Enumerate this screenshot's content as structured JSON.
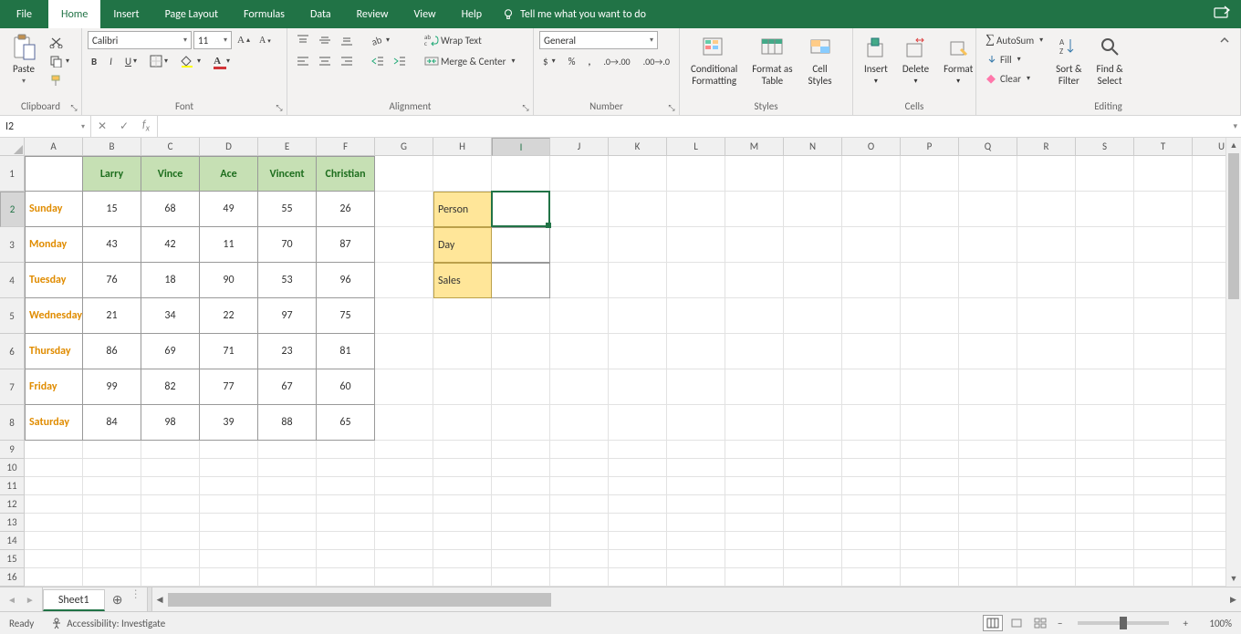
{
  "tabs": {
    "file": "File",
    "home": "Home",
    "insert": "Insert",
    "page_layout": "Page Layout",
    "formulas": "Formulas",
    "data": "Data",
    "review": "Review",
    "view": "View",
    "help": "Help"
  },
  "tell_me": "Tell me what you want to do",
  "ribbon": {
    "clipboard": {
      "paste": "Paste",
      "label": "Clipboard"
    },
    "font": {
      "name": "Calibri",
      "size": "11",
      "label": "Font"
    },
    "alignment": {
      "wrap": "Wrap Text",
      "merge": "Merge & Center",
      "label": "Alignment"
    },
    "number": {
      "format": "General",
      "label": "Number"
    },
    "styles": {
      "cond": "Conditional\nFormatting",
      "table": "Format as\nTable",
      "cell": "Cell\nStyles",
      "label": "Styles"
    },
    "cells": {
      "insert": "Insert",
      "delete": "Delete",
      "format": "Format",
      "label": "Cells"
    },
    "editing": {
      "sum": "AutoSum",
      "fill": "Fill",
      "clear": "Clear",
      "sort": "Sort &\nFilter",
      "find": "Find &\nSelect",
      "label": "Editing"
    }
  },
  "namebox": "I2",
  "columns": [
    "A",
    "B",
    "C",
    "D",
    "E",
    "F",
    "G",
    "H",
    "I",
    "J",
    "K",
    "L",
    "M",
    "N",
    "O",
    "P",
    "Q",
    "R",
    "S",
    "T",
    "U"
  ],
  "col_widths": {
    "A": 64,
    "default": 64
  },
  "row_heights": {
    "big": 39,
    "d": 20
  },
  "headers": [
    "Larry",
    "Vince",
    "Ace",
    "Vincent",
    "Christian"
  ],
  "days": [
    "Sunday",
    "Monday",
    "Tuesday",
    "Wednesday",
    "Thursday",
    "Friday",
    "Saturday"
  ],
  "data": [
    [
      15,
      68,
      49,
      55,
      26
    ],
    [
      43,
      42,
      11,
      70,
      87
    ],
    [
      76,
      18,
      90,
      53,
      96
    ],
    [
      21,
      34,
      22,
      97,
      75
    ],
    [
      86,
      69,
      71,
      23,
      81
    ],
    [
      99,
      82,
      77,
      67,
      60
    ],
    [
      84,
      98,
      39,
      88,
      65
    ]
  ],
  "lookup": [
    "Person",
    "Day",
    "Sales"
  ],
  "sheet": "Sheet1",
  "status": {
    "ready": "Ready",
    "access": "Accessibility: Investigate",
    "zoom": "100%"
  }
}
